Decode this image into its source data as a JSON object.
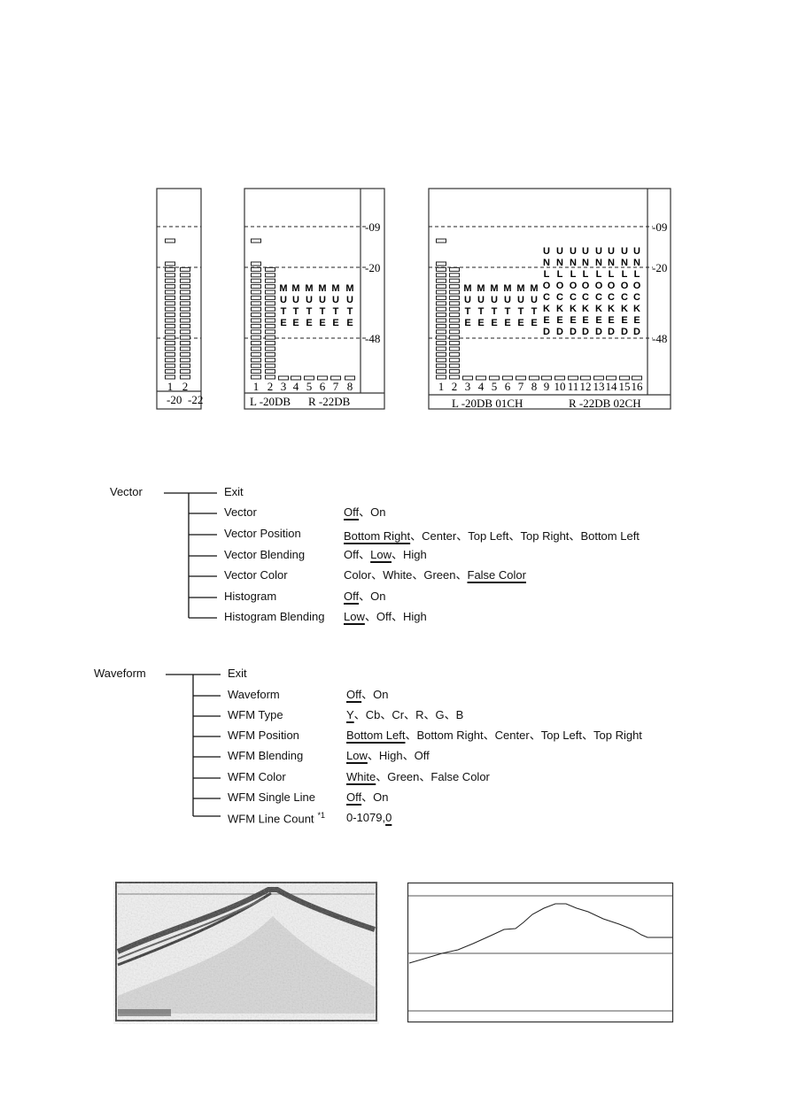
{
  "meters": [
    {
      "channels": [
        {
          "label": "1",
          "state": "level",
          "segments": 21,
          "peak": true
        },
        {
          "label": "2",
          "state": "level",
          "segments": 20,
          "peak": false
        }
      ],
      "footer": [
        "-20",
        "-22"
      ],
      "scale": []
    },
    {
      "channels": [
        {
          "label": "1",
          "state": "level",
          "segments": 21,
          "peak": true
        },
        {
          "label": "2",
          "state": "level",
          "segments": 20,
          "peak": false
        },
        {
          "label": "3",
          "state": "MUTE"
        },
        {
          "label": "4",
          "state": "MUTE"
        },
        {
          "label": "5",
          "state": "MUTE"
        },
        {
          "label": "6",
          "state": "MUTE"
        },
        {
          "label": "7",
          "state": "MUTE"
        },
        {
          "label": "8",
          "state": "MUTE"
        }
      ],
      "footer": [
        "L -20DB",
        "R -22DB"
      ],
      "scale": [
        "-09",
        "-20",
        "-48"
      ]
    },
    {
      "channels": [
        {
          "label": "1",
          "state": "level",
          "segments": 21,
          "peak": true
        },
        {
          "label": "2",
          "state": "level",
          "segments": 20,
          "peak": false
        },
        {
          "label": "3",
          "state": "MUTE"
        },
        {
          "label": "4",
          "state": "MUTE"
        },
        {
          "label": "5",
          "state": "MUTE"
        },
        {
          "label": "6",
          "state": "MUTE"
        },
        {
          "label": "7",
          "state": "MUTE"
        },
        {
          "label": "8",
          "state": "MUTE"
        },
        {
          "label": "9",
          "state": "UNLOCKED"
        },
        {
          "label": "10",
          "state": "UNLOCKED"
        },
        {
          "label": "11",
          "state": "UNLOCKED"
        },
        {
          "label": "12",
          "state": "UNLOCKED"
        },
        {
          "label": "13",
          "state": "UNLOCKED"
        },
        {
          "label": "14",
          "state": "UNLOCKED"
        },
        {
          "label": "15",
          "state": "UNLOCKED"
        },
        {
          "label": "16",
          "state": "UNLOCKED"
        }
      ],
      "footer": [
        "L -20DB 01CH",
        "R -22DB 02CH"
      ],
      "scale": [
        "-09",
        "-20",
        "-48"
      ]
    }
  ],
  "vector_menu": {
    "title": "Vector",
    "items": [
      {
        "label": "Exit",
        "options": [],
        "selected": -1
      },
      {
        "label": "Vector",
        "options": [
          "Off",
          "On"
        ],
        "selected": 0
      },
      {
        "label": "Vector Position",
        "options": [
          "Bottom Right",
          "Center",
          "Top Left",
          "Top Right",
          "Bottom Left"
        ],
        "selected": 0
      },
      {
        "label": "Vector Blending",
        "options": [
          "Off",
          "Low",
          "High"
        ],
        "selected": 1
      },
      {
        "label": "Vector Color",
        "options": [
          "Color",
          "White",
          "Green",
          "False Color"
        ],
        "selected": 3
      },
      {
        "label": "Histogram",
        "options": [
          "Off",
          "On"
        ],
        "selected": 0
      },
      {
        "label": "Histogram Blending",
        "options": [
          "Low",
          "Off",
          "High"
        ],
        "selected": 0
      }
    ]
  },
  "waveform_menu": {
    "title": "Waveform",
    "items": [
      {
        "label": "Exit",
        "options": [],
        "selected": -1
      },
      {
        "label": "Waveform",
        "options": [
          "Off",
          "On"
        ],
        "selected": 0
      },
      {
        "label": "WFM Type",
        "options": [
          "Y",
          "Cb",
          "Cr",
          "R",
          "G",
          "B"
        ],
        "selected": 0
      },
      {
        "label": "WFM Position",
        "options": [
          "Bottom Left",
          "Bottom Right",
          "Center",
          "Top Left",
          "Top Right"
        ],
        "selected": 0
      },
      {
        "label": "WFM Blending",
        "options": [
          "Low",
          "High",
          "Off"
        ],
        "selected": 0
      },
      {
        "label": "WFM Color",
        "options": [
          "White",
          "Green",
          "False Color"
        ],
        "selected": 0
      },
      {
        "label": "WFM Single Line",
        "options": [
          "Off",
          "On"
        ],
        "selected": 0
      },
      {
        "label": "WFM Line Count",
        "footnote": "*1",
        "range": "0-1079,",
        "options": [
          "0"
        ],
        "selected": 0
      }
    ]
  },
  "separator": "、"
}
